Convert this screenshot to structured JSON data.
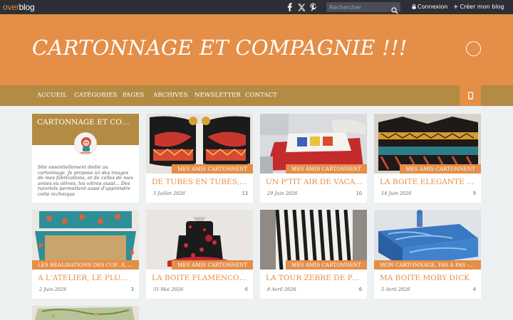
{
  "topbar": {
    "logo_part1": "over",
    "logo_part2": "blog",
    "social_icons": [
      "facebook-icon",
      "x-icon",
      "pinterest-icon"
    ],
    "search_placeholder": "Rechercher",
    "login_label": "Connexion",
    "create_label": "Créer mon blog"
  },
  "header": {
    "title": "CARTONNAGE ET COMPAGNIE !!!"
  },
  "nav": {
    "items": [
      "ACCUEIL",
      "CATÉGORIES",
      "PAGES",
      "ARCHIVES",
      "NEWSLETTER",
      "CONTACT"
    ]
  },
  "profile": {
    "title": "CARTONNAGE ET COMPAGNIE !!!",
    "description": "Site essentiellement dédié au cartonnage. Je propose ici des images de mes fabrications, et de celles de mes amies ou élèves, les vôtres aussi... Des tutoriels permettent aussi d'apprendre cette technique"
  },
  "articles": [
    {
      "category": "MES AMIS CARTONNENT",
      "title": "DE TUBES EN TUBES, \"L'INSOLITE\"",
      "date": "5 Juillet 2026",
      "count": "13"
    },
    {
      "category": "MES AMIS CARTONNENT",
      "title": "UN P'TIT AIR DE VACANCES",
      "date": "29 Juin 2026",
      "count": "10"
    },
    {
      "category": "MES AMIS CARTONNENT",
      "title": "LA BOITE ELEGANTE ET SOBRE",
      "date": "14 Juin 2026",
      "count": "9"
    },
    {
      "category": "LES RÉALISATIONS DES COP...S, PAS À PAS - TECHNIQUES",
      "title": "A L'ATELIER, LE PLUMIER",
      "date": "2 Juin 2026",
      "count": "3"
    },
    {
      "category": "MES AMIS CARTONNENT",
      "title": "LA BOITE FLAMENCO DE JOSETTE",
      "date": "31 Mai 2026",
      "count": "6"
    },
    {
      "category": "MES AMIS CARTONNENT",
      "title": "LA TOUR ZEBRE DE PAULETTE",
      "date": "8 Avril 2026",
      "count": "6"
    },
    {
      "category": "MON CARTONNAGE, PAS À PAS - TECHNIQUES",
      "title": "MA BOITE MOBY DICK",
      "date": "5 Avril 2026",
      "count": "4"
    }
  ],
  "colors": {
    "accent": "#e48e47",
    "nav": "#b38b43",
    "topbar": "#2c2f33",
    "background": "#eef1f2"
  }
}
